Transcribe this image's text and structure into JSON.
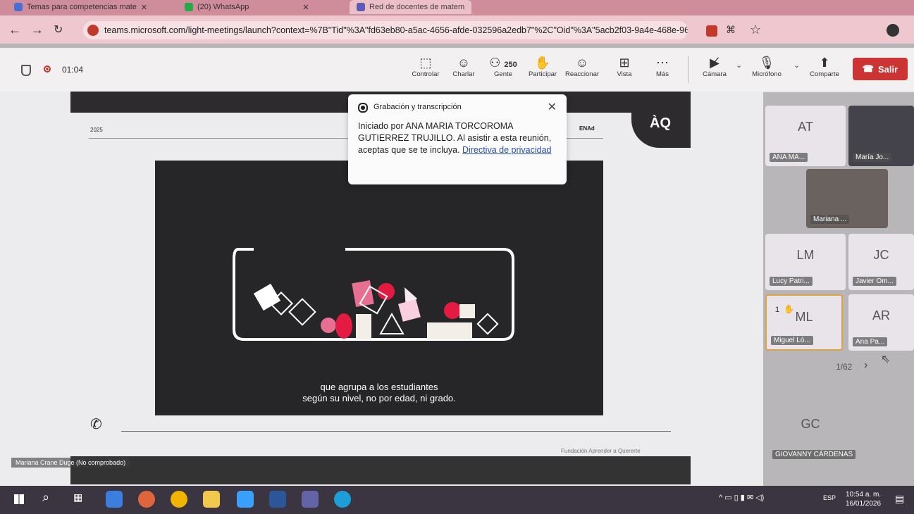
{
  "browser": {
    "tabs": [
      {
        "label": "Temas para competencias mate",
        "close": "✕"
      },
      {
        "label": "(20) WhatsApp",
        "close": "✕"
      },
      {
        "label": "Red de docentes de matem"
      }
    ],
    "url": "teams.microsoft.com/light-meetings/launch?context=%7B\"Tid\"%3A\"fd63eb80-a5ac-4656-afde-032596a2edb7\"%2C\"Oid\"%3A\"5acb2f03-9a4e-468e-9676-88d2a63..."
  },
  "meeting": {
    "timer": "01:04",
    "toolbar": [
      {
        "icon": "control-icon",
        "label": "Controlar"
      },
      {
        "icon": "chat-icon",
        "label": "Charlar"
      },
      {
        "icon": "people-icon",
        "label": "Gente",
        "count": "250"
      },
      {
        "icon": "raise-hand-icon",
        "label": "Participar"
      },
      {
        "icon": "react-icon",
        "label": "Reaccionar"
      },
      {
        "icon": "view-icon",
        "label": "Vista"
      },
      {
        "icon": "more-icon",
        "label": "Más"
      }
    ],
    "camera_label": "Cámara",
    "mic_label": "Micrófono",
    "share_label": "Comparte",
    "leave_label": "Salir"
  },
  "popup": {
    "title": "Grabación y transcripción",
    "body": "Iniciado por ANA MARIA TORCOROMA GUTIERREZ TRUJILLO. Al asistir a esta reunión, aceptas que se te incluya.",
    "link": "Directiva de privacidad"
  },
  "slide": {
    "year": "2025",
    "brand": "ENAd",
    "footer": "Fundación Aprender a Quererte",
    "caption_line1": "que agrupa a los estudiantes",
    "caption_line2": "según su nivel, no por edad, ni grado.",
    "presenter_label": "Mariana Crane Duge (No comprobado)"
  },
  "participants": [
    {
      "initials": "AT",
      "name": "ANA MA..."
    },
    {
      "initials": "",
      "name": "María Jo..."
    },
    {
      "initials": "",
      "name": "Mariana ..."
    },
    {
      "initials": "LM",
      "name": "Lucy Patri..."
    },
    {
      "initials": "JC",
      "name": "Javier Om..."
    },
    {
      "initials": "ML",
      "name": "Miguel Ló...",
      "hand": "1"
    },
    {
      "initials": "AR",
      "name": "Ana Pa..."
    },
    {
      "initials": "GC",
      "name": "GIOVANNY CÁRDENAS"
    }
  ],
  "pagination": "1/62",
  "taskbar": {
    "time": "10:54 a. m.",
    "date": "16/01/2026",
    "lang": "ESP"
  }
}
